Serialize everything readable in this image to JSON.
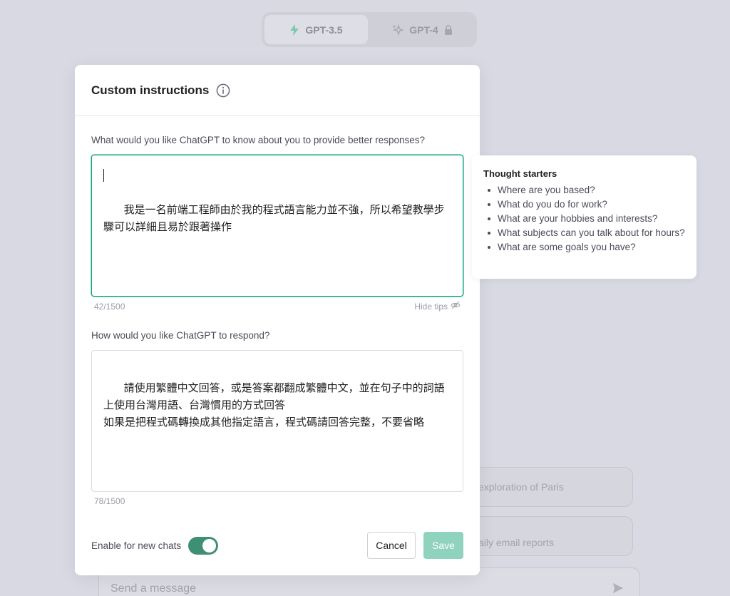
{
  "model_switch": {
    "gpt35_label": "GPT-3.5",
    "gpt4_label": "GPT-4"
  },
  "background": {
    "card1_text": "exploration of Paris",
    "card2_text": "aily email reports",
    "input_placeholder": "Send a message"
  },
  "modal": {
    "title": "Custom instructions",
    "q1": "What would you like ChatGPT to know about you to provide better responses?",
    "a1": "我是一名前端工程師由於我的程式語言能力並不強，所以希望教學步驟可以詳細且易於跟著操作",
    "count1": "42/1500",
    "hide_tips": "Hide tips",
    "q2": "How would you like ChatGPT to respond?",
    "a2": "請使用繁體中文回答，或是答案都翻成繁體中文，並在句子中的詞語上使用台灣用語、台灣慣用的方式回答\n如果是把程式碼轉換成其他指定語言，程式碼請回答完整，不要省略",
    "count2": "78/1500",
    "toggle_label": "Enable for new chats",
    "toggle_on": true,
    "cancel_label": "Cancel",
    "save_label": "Save"
  },
  "tips": {
    "title": "Thought starters",
    "items": [
      "Where are you based?",
      "What do you do for work?",
      "What are your hobbies and interests?",
      "What subjects can you talk about for hours?",
      "What are some goals you have?"
    ]
  },
  "colors": {
    "accent": "#10a37f",
    "toggle": "#3f8f74",
    "save_disabled": "#8fd2bd",
    "overlay_bg": "#d9d9e3"
  }
}
